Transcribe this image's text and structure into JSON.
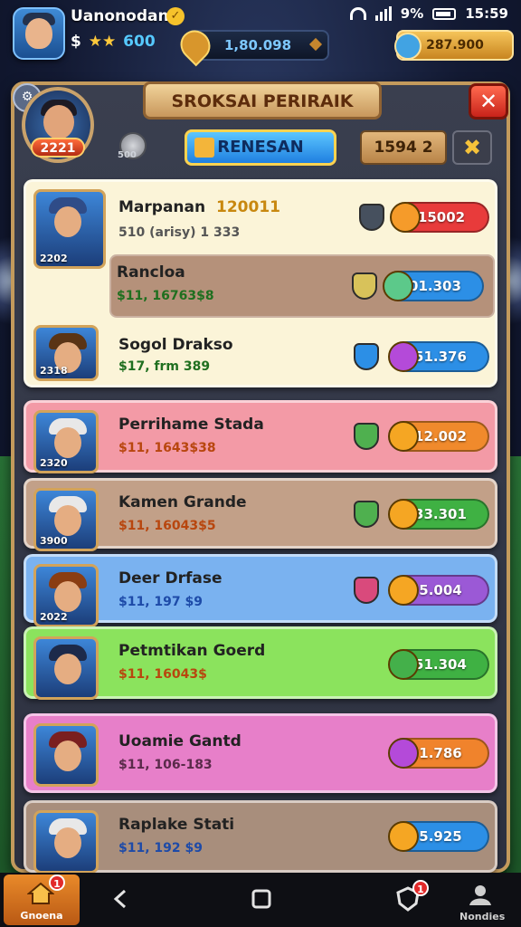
{
  "status_bar": {
    "battery": "9%",
    "time": "15:59"
  },
  "user": {
    "name": "Uanonodan",
    "currency_symbol": "$",
    "stars": "★★",
    "balance": "600"
  },
  "currencies": {
    "gems": "1,80.098",
    "gold": "287.900"
  },
  "panel": {
    "title": "SROKSAI PERIRAIK",
    "close_label": "✕",
    "profile_level": "2221",
    "coin_value": "500",
    "renew_label": "RENESAN",
    "counter_value": "1594 2"
  },
  "rows": [
    {
      "name": "Marpanan",
      "extra": "120011",
      "stat": "510 (arisy) 1 333",
      "value": "15002",
      "pill_color": "#e83b3b",
      "coin_color": "#f59b2a",
      "shield_color": "#46505e",
      "bg": "#fbf4d8",
      "level": "2202"
    },
    {
      "name": "Rancloa",
      "stat": "$11, 16763$8",
      "value": "01.303",
      "pill_color": "#2c8fe6",
      "coin_color": "#5cc98a",
      "shield_color": "#d8c25a",
      "bg": "#b5917a"
    },
    {
      "name": "Sogol Drakso",
      "stat": "$17, frm 389",
      "value": "51.376",
      "pill_color": "#2c8fe6",
      "coin_color": "#b44ad9",
      "shield_color": "#2c8fe6",
      "bg": "#fbf0c8",
      "level": "2318"
    },
    {
      "name": "Perrihame Stada",
      "stat": "$11, 1643$38",
      "value": "12.002",
      "pill_color": "#f08a2c",
      "coin_color": "#f5a623",
      "shield_color": "#4fb04f",
      "bg": "#f39aa6",
      "level": "2320"
    },
    {
      "name": "Kamen Grande",
      "stat": "$11, 16043$5",
      "value": "33.301",
      "pill_color": "#3fb143",
      "coin_color": "#f5a623",
      "shield_color": "#4fb04f",
      "bg": "#c2a088",
      "level": "3900"
    },
    {
      "name": "Deer Drfase",
      "stat": "$11, 197 $9",
      "value": "5.004",
      "pill_color": "#9b59d6",
      "coin_color": "#f5a623",
      "shield_color": "#d94a7c",
      "bg": "#7ab2f0",
      "level": "2022"
    },
    {
      "name": "Petmtikan Goerd",
      "stat": "$11, 16043$",
      "value": "51.304",
      "pill_color": "#3fb143",
      "coin_color": "#44b04a",
      "shield_color": "#44b04a",
      "bg": "#8be35d",
      "level": ""
    },
    {
      "name": "Uoamie Gantd",
      "stat": "$11, 106-183",
      "value": "1.786",
      "pill_color": "#f0832c",
      "coin_color": "#b44ad9",
      "shield_color": "#b44ad9",
      "bg": "#e77fc9",
      "level": ""
    },
    {
      "name": "Raplake Stati",
      "stat": "$11, 192 $9",
      "value": "5.925",
      "pill_color": "#2c8fe6",
      "coin_color": "#f5a623",
      "shield_color": "#2c8fe6",
      "bg": "#a88e7c",
      "level": ""
    }
  ],
  "nav": {
    "home_label": "Gnoena",
    "home_badge": "1",
    "right_badge": "1",
    "right_label": "Nondies"
  }
}
